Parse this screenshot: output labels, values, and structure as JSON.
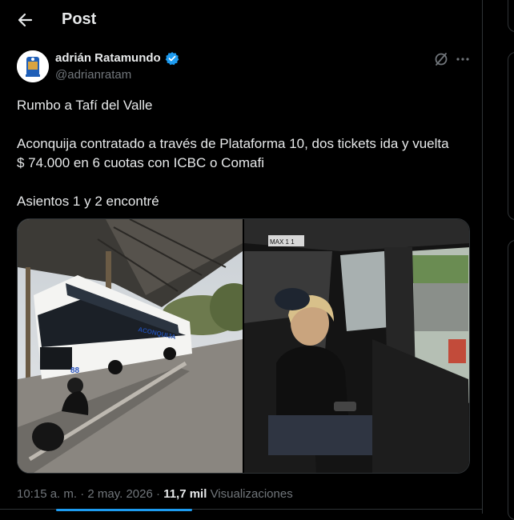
{
  "header": {
    "title": "Post",
    "back_icon": "arrow-left-icon"
  },
  "author": {
    "name": "adrián Ratamundo",
    "handle": "@adrianratam",
    "verified_icon": "verified-badge-icon",
    "verified_color": "#1d9bf0"
  },
  "actions": {
    "grok_icon": "grok-icon",
    "more_icon": "more-horizontal-icon"
  },
  "post": {
    "line1": "Rumbo a Tafí del Valle",
    "line2": "Aconquija contratado a través de Plataforma 10, dos tickets ida y vuelta",
    "line3": "$ 74.000 en 6 cuotas con ICBC o Comafi",
    "line4": "Asientos 1 y 2 encontré"
  },
  "media": {
    "photo1_bus_number": "88",
    "photo1_bus_brand": "ACONQUIJA",
    "photo2_sign": "MAX 1 1"
  },
  "meta": {
    "time": "10:15 a. m.",
    "separator": " · ",
    "date": "2 may. 2026",
    "views_count": "11,7 mil",
    "views_label": "Visualizaciones"
  },
  "colors": {
    "background": "#000000",
    "text": "#e7e9ea",
    "secondary_text": "#71767b",
    "accent": "#1d9bf0",
    "border": "#2f3336"
  }
}
